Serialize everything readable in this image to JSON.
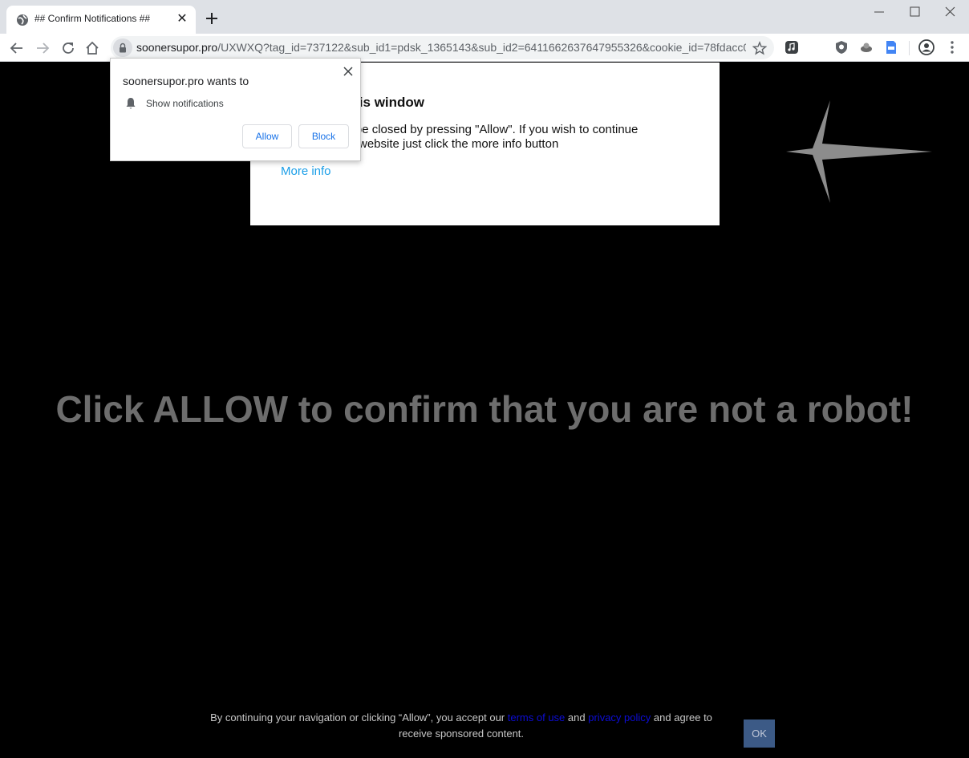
{
  "browser": {
    "tab_title": "## Confirm Notifications ##",
    "url_host": "soonersupor.pro",
    "url_path": "/UXWXQ?tag_id=737122&sub_id1=pdsk_1365143&sub_id2=6411662637647955326&cookie_id=78fdacc0-..."
  },
  "prompt": {
    "title": "soonersupor.pro wants to",
    "permission": "Show notifications",
    "allow_label": "Allow",
    "block_label": "Block"
  },
  "page": {
    "box_heading": "\" to close this window",
    "box_body_line1": "an be closed by pressing \"Allow\". If you wish to continue",
    "box_body_line2": "website just click the more info button",
    "more_info": "More info",
    "robot_text": "Click ALLOW to confirm that you are not a robot!",
    "consent_pre": "By continuing your navigation or clicking “Allow”, you accept our",
    "terms_link": "terms of use",
    "consent_and": "and",
    "privacy_link": "privacy policy",
    "consent_post": "and agree to receive sponsored content.",
    "ok_label": "OK"
  },
  "colors": {
    "background": "#000000",
    "robot_text": "#6d6d6d",
    "link": "#1a9ee8",
    "ok_button": "#3c5a86"
  }
}
